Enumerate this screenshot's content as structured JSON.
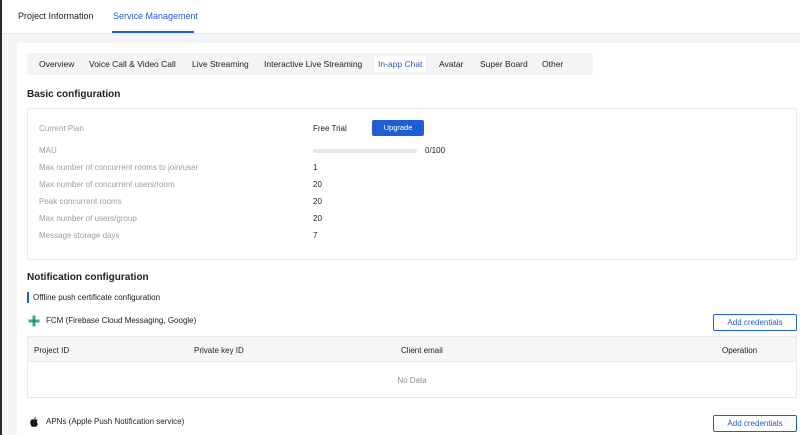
{
  "top_tabs": [
    {
      "label": "Project Information",
      "active": false
    },
    {
      "label": "Service Management",
      "active": true
    }
  ],
  "service_tabs": [
    {
      "label": "Overview",
      "active": false
    },
    {
      "label": "Voice Call & Video Call",
      "active": false
    },
    {
      "label": "Live Streaming",
      "active": false
    },
    {
      "label": "Interactive Live Streaming",
      "active": false
    },
    {
      "label": "In-app Chat",
      "active": true
    },
    {
      "label": "Avatar",
      "active": false
    },
    {
      "label": "Super Board",
      "active": false
    },
    {
      "label": "Other",
      "active": false
    }
  ],
  "basic": {
    "title": "Basic configuration",
    "plan_label": "Current Plan",
    "plan_value": "Free Trial",
    "upgrade_label": "Upgrade",
    "mau_label": "MAU",
    "mau_count": "0/100",
    "mau_progress": 0,
    "rows": [
      {
        "label": "Max number of concurrent rooms to join/user",
        "value": "1"
      },
      {
        "label": "Max number of concurrent users/room",
        "value": "20"
      },
      {
        "label": "Peak concurrent rooms",
        "value": "20"
      },
      {
        "label": "Max number of users/group",
        "value": "20"
      },
      {
        "label": "Message storage days",
        "value": "7"
      }
    ]
  },
  "notification": {
    "title": "Notification configuration",
    "subtitle": "Offline push certificate configuration",
    "fcm": {
      "name": "FCM (Firebase Cloud Messaging, Google)",
      "icon": "firebase-icon",
      "add_label": "Add credentials",
      "columns": [
        "Project ID",
        "Private key ID",
        "Client email",
        "Operation"
      ],
      "empty_text": "No Data"
    },
    "apns": {
      "name": "APNs (Apple Push Notification service)",
      "icon": "apple-icon",
      "add_label": "Add credentials"
    }
  },
  "colors": {
    "accent": "#1f5fd6",
    "muted": "#9aa0a8",
    "firebase": "#38b27a"
  }
}
